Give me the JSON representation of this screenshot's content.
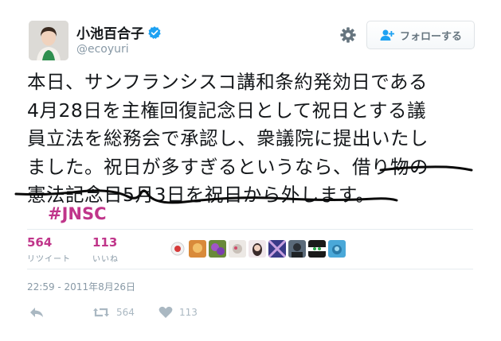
{
  "author": {
    "name": "小池百合子",
    "handle": "@ecoyuri",
    "verified_icon": "verified-badge-icon",
    "accent": "#1da1f2"
  },
  "follow_button": {
    "label": "フォローする",
    "icon": "add-user-icon"
  },
  "tweet": {
    "text_lines": [
      "本日、サンフランシスコ講和条約発効日である",
      "4月28日を主権回復記念日として祝日とする議",
      "員立法を総務会で承認し、衆議院に提出いたし",
      "ました。祝日が多すぎるというなら、借り物の",
      "憲法記念日5月3日を祝日から外します。"
    ],
    "hashtag": "#JNSC",
    "hashtag_color": "#c0358a"
  },
  "stats": {
    "retweets": {
      "value": "564",
      "label": "リツイート"
    },
    "likes": {
      "value": "113",
      "label": "いいね"
    },
    "value_color": "#c0358a"
  },
  "timestamp": "22:59 - 2011年8月26日",
  "actions": {
    "reply_icon": "reply-icon",
    "retweet_icon": "retweet-icon",
    "retweet_count": "564",
    "like_icon": "heart-icon",
    "like_count": "113"
  }
}
